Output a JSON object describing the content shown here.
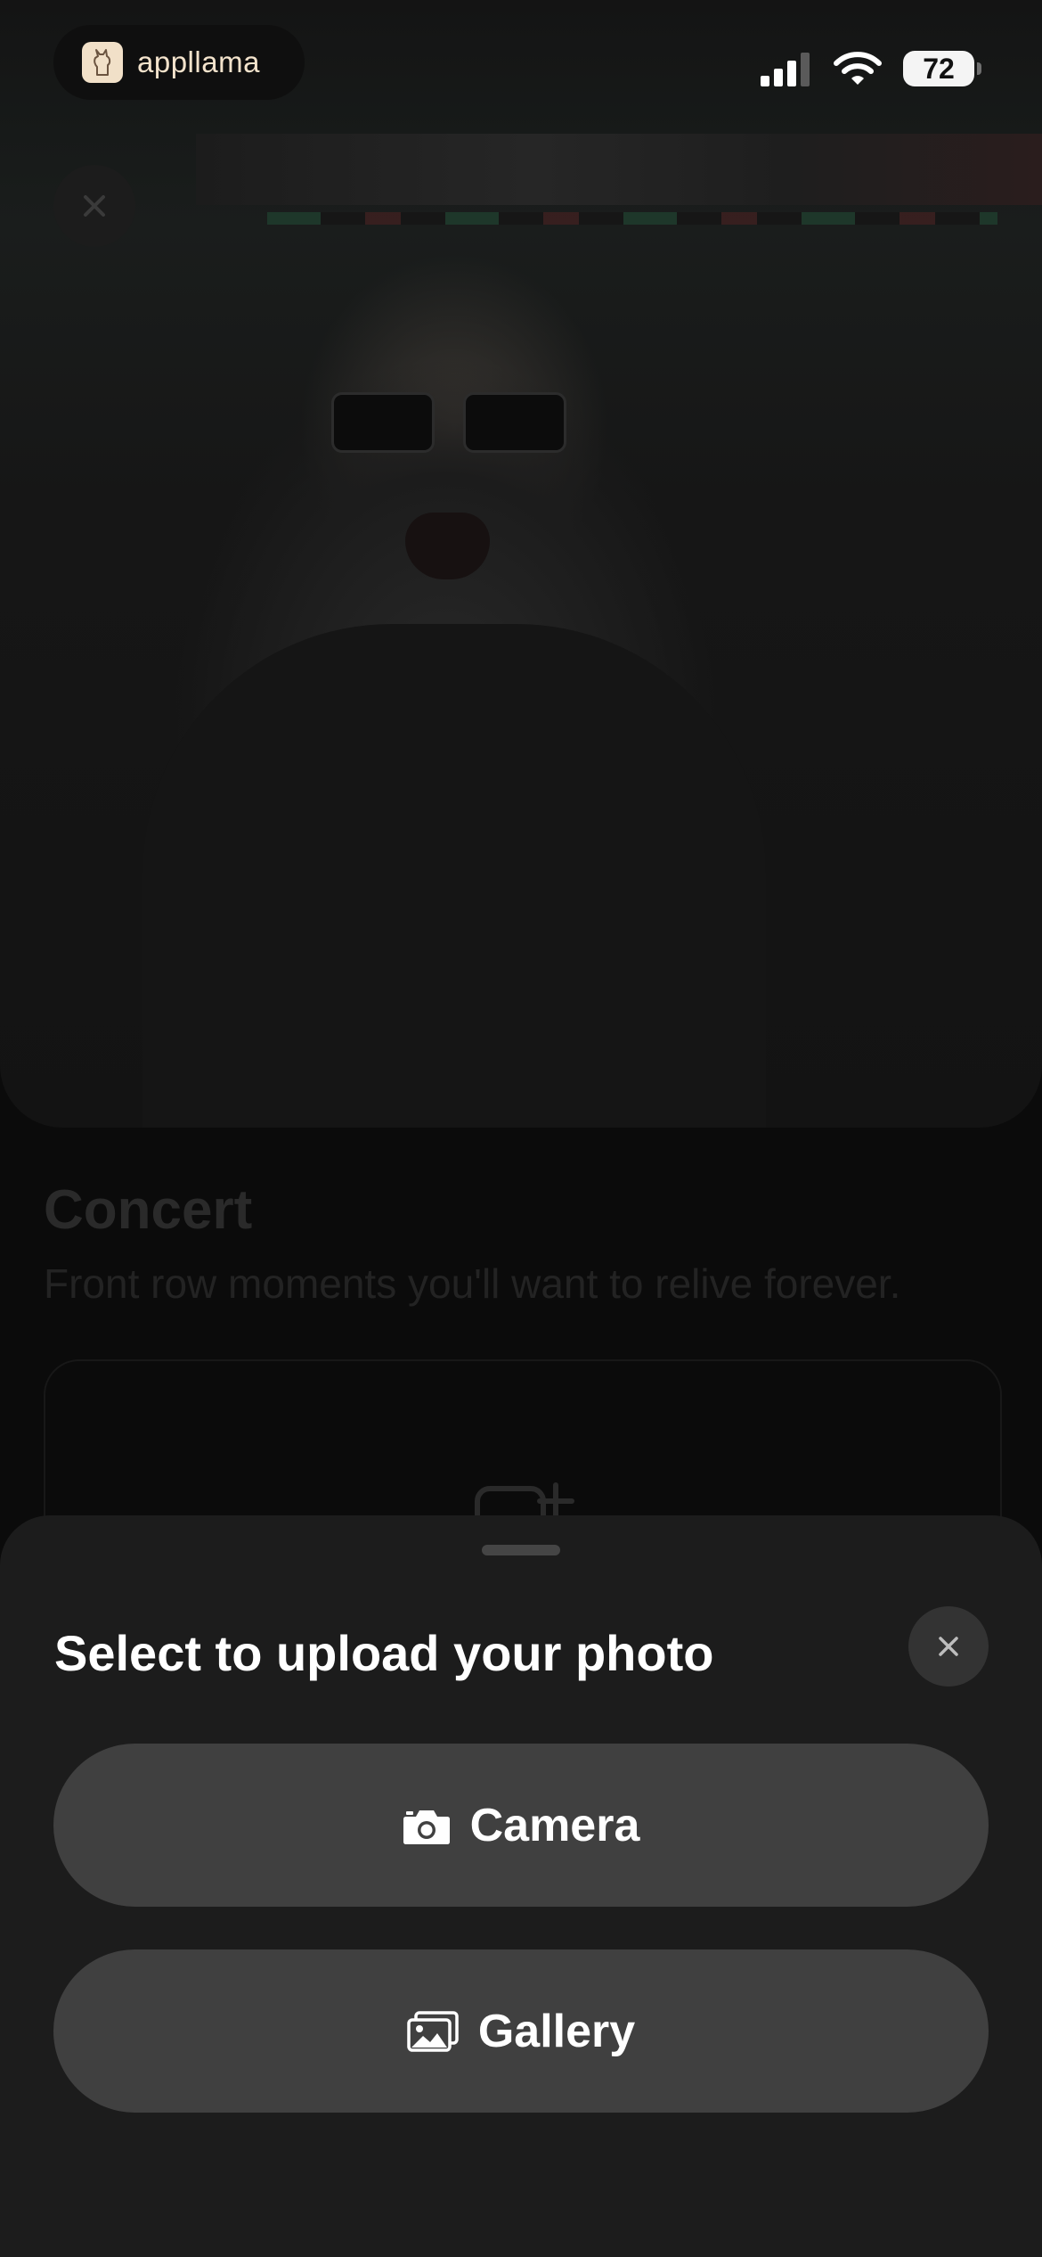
{
  "status_bar": {
    "app_name": "appllama",
    "battery": "72"
  },
  "background": {
    "title": "Concert",
    "subtitle": "Front row moments you'll want to relive forever."
  },
  "sheet": {
    "title": "Select to upload your photo",
    "options": [
      {
        "label": "Camera",
        "icon": "camera-icon"
      },
      {
        "label": "Gallery",
        "icon": "gallery-icon"
      }
    ]
  },
  "colors": {
    "sheet_bg": "#1c1c1c",
    "button_bg": "#404040",
    "close_bg": "#333333",
    "text": "#ffffff"
  }
}
